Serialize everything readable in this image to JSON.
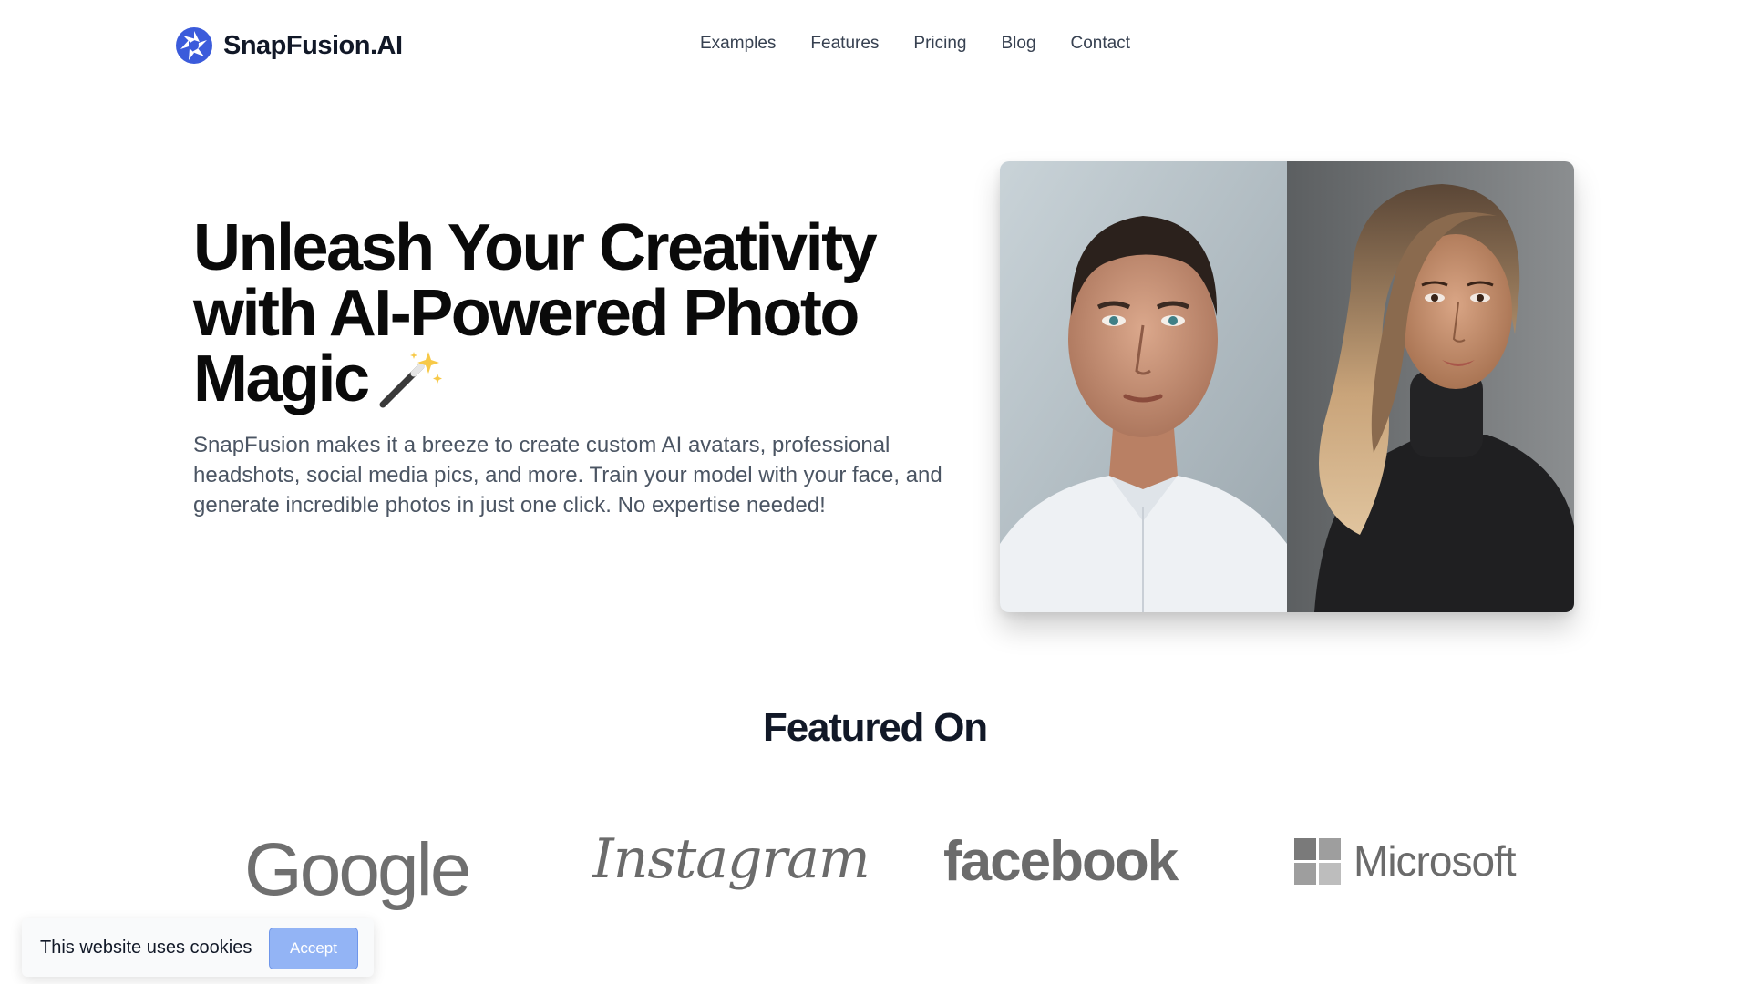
{
  "brand": {
    "name": "SnapFusion.AI",
    "logo_icon": "aperture-icon",
    "accent": "#3b5bdb"
  },
  "nav": {
    "items": [
      {
        "label": "Examples"
      },
      {
        "label": "Features"
      },
      {
        "label": "Pricing"
      },
      {
        "label": "Blog"
      },
      {
        "label": "Contact"
      }
    ]
  },
  "hero": {
    "title": "Unleash Your Creativity with AI-Powered Photo Magic",
    "title_icon": "magic-wand-icon",
    "subtitle": "SnapFusion makes it a breeze to create custom AI avatars, professional headshots, social media pics, and more. Train your model with your face, and generate incredible photos in just one click. No expertise needed!",
    "image": {
      "left": "man-portrait",
      "right": "woman-portrait"
    }
  },
  "featured": {
    "title": "Featured On",
    "logos": [
      "Google",
      "Instagram",
      "facebook",
      "Microsoft"
    ]
  },
  "cookie": {
    "text": "This website uses cookies",
    "accept_label": "Accept",
    "accept_color": "#93b4f5"
  }
}
